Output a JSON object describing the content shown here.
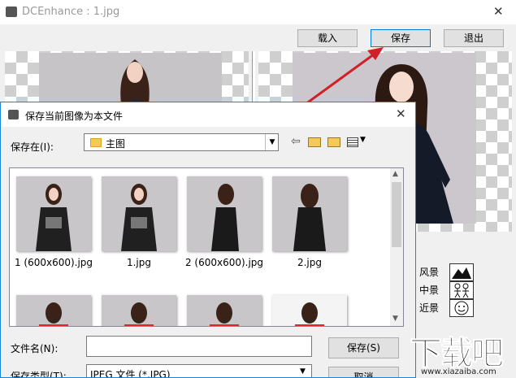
{
  "main_window": {
    "title": "DCEnhance : 1.jpg",
    "close_glyph": "✕",
    "buttons": {
      "load": "载入",
      "save": "保存",
      "exit": "退出"
    },
    "scene_modes": [
      {
        "label": "风景",
        "icon": "landscape-icon"
      },
      {
        "label": "中景",
        "icon": "people-icon"
      },
      {
        "label": "近景",
        "icon": "face-icon"
      }
    ]
  },
  "dialog": {
    "title": "保存当前图像为本文件",
    "close_glyph": "✕",
    "save_in_label": "保存在(I):",
    "save_in_value": "主图",
    "files": [
      {
        "name": "1 (600x600).jpg",
        "style": "front-black"
      },
      {
        "name": "1.jpg",
        "style": "front-black"
      },
      {
        "name": "2 (600x600).jpg",
        "style": "side-black"
      },
      {
        "name": "2.jpg",
        "style": "back-black"
      },
      {
        "name": "",
        "style": "red"
      },
      {
        "name": "",
        "style": "red"
      },
      {
        "name": "",
        "style": "red"
      },
      {
        "name": "",
        "style": "red-white"
      }
    ],
    "filename_label": "文件名(N):",
    "filename_value": "",
    "filetype_label": "保存类型(T):",
    "filetype_value": "JPEG 文件  (*.JPG)",
    "save_button": "保存(S)",
    "cancel_button": "取消"
  },
  "watermark": {
    "text": "下载吧",
    "url": "www.xiazaiba.com"
  },
  "colors": {
    "accent": "#0078d7",
    "arrow": "#d0202a",
    "dialog_border": "#1883d7"
  }
}
